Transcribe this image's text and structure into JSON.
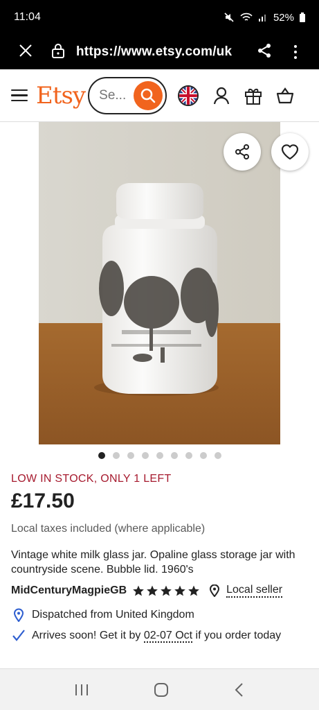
{
  "status_bar": {
    "time": "11:04",
    "battery": "52%"
  },
  "browser": {
    "url": "https://www.etsy.com/uk"
  },
  "header": {
    "logo": "Etsy",
    "search_placeholder": "Se..."
  },
  "gallery": {
    "image_count": 9,
    "active_index": 0
  },
  "listing": {
    "stock_alert": "LOW IN STOCK, ONLY 1 LEFT",
    "price": "£17.50",
    "taxes_note": "Local taxes included (where applicable)",
    "title": "Vintage white milk glass jar. Opaline glass storage jar with countryside scene. Bubble lid. 1960's",
    "seller": "MidCenturyMagpieGB",
    "rating_stars": 5,
    "local_seller": "Local seller",
    "dispatch": "Dispatched from United Kingdom",
    "arrival_prefix": "Arrives soon! Get it by ",
    "arrival_dates": "02-07 Oct",
    "arrival_suffix": " if you order today"
  },
  "colors": {
    "brand": "#f1641e",
    "stock_alert": "#a61a2e",
    "delivery_icon": "#2f5fd0"
  }
}
